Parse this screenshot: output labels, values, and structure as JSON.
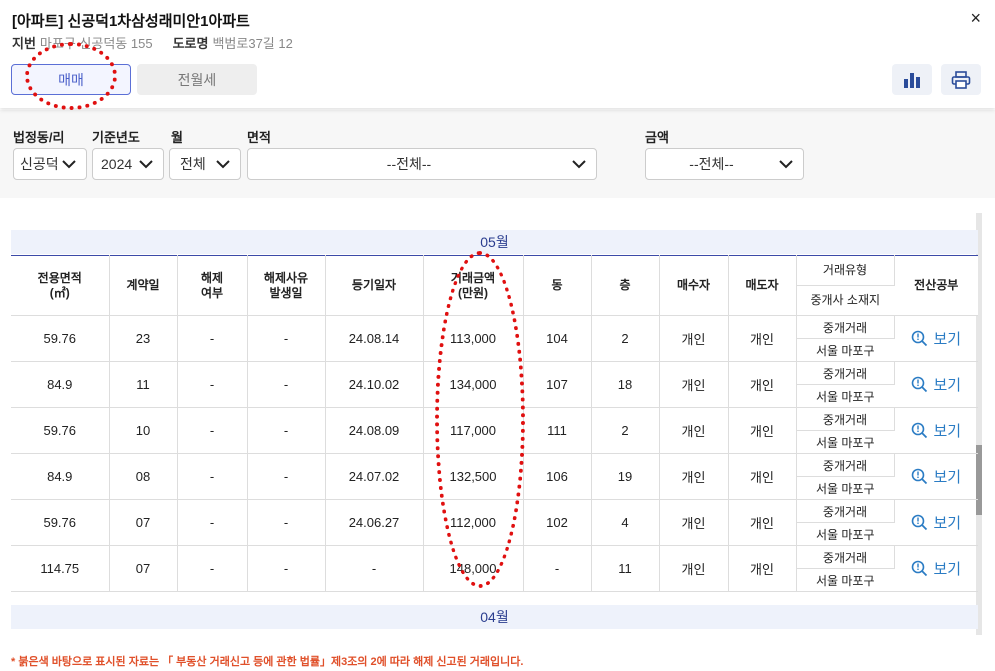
{
  "header": {
    "title": "[아파트] 신공덕1차삼성래미안1아파트",
    "lot_label": "지번",
    "lot_value": "마포구 신공덕동 155",
    "road_label": "도로명",
    "road_value": "백범로37길 12",
    "close": "×"
  },
  "tabs": [
    {
      "label": "매매",
      "active": true
    },
    {
      "label": "전월세",
      "active": false
    }
  ],
  "filters": {
    "dong": {
      "label": "법정동/리",
      "value": "신공덕"
    },
    "year": {
      "label": "기준년도",
      "value": "2024"
    },
    "month": {
      "label": "월",
      "value": "전체"
    },
    "area": {
      "label": "면적",
      "value": "--전체--"
    },
    "amount": {
      "label": "금액",
      "value": "--전체--"
    }
  },
  "table": {
    "headers": {
      "area": "전용면적\n(㎡)",
      "day": "계약일",
      "cancel": "해제\n여부",
      "cancel_date": "해제사유\n발생일",
      "reg_date": "등기일자",
      "price": "거래금액\n(만원)",
      "building": "동",
      "floor": "층",
      "buyer": "매수자",
      "seller": "매도자",
      "trade_type": "거래유형",
      "broker_loc": "중개사 소재지",
      "doc": "전산공부"
    },
    "month_may": "05월",
    "month_apr": "04월",
    "rows": [
      {
        "area": "59.76",
        "day": "23",
        "cancel": "-",
        "cancel_date": "-",
        "reg_date": "24.08.14",
        "price": "113,000",
        "building": "104",
        "floor": "2",
        "buyer": "개인",
        "seller": "개인",
        "trade_type": "중개거래",
        "broker_loc": "서울 마포구",
        "doc": "보기"
      },
      {
        "area": "84.9",
        "day": "11",
        "cancel": "-",
        "cancel_date": "-",
        "reg_date": "24.10.02",
        "price": "134,000",
        "building": "107",
        "floor": "18",
        "buyer": "개인",
        "seller": "개인",
        "trade_type": "중개거래",
        "broker_loc": "서울 마포구",
        "doc": "보기"
      },
      {
        "area": "59.76",
        "day": "10",
        "cancel": "-",
        "cancel_date": "-",
        "reg_date": "24.08.09",
        "price": "117,000",
        "building": "111",
        "floor": "2",
        "buyer": "개인",
        "seller": "개인",
        "trade_type": "중개거래",
        "broker_loc": "서울 마포구",
        "doc": "보기"
      },
      {
        "area": "84.9",
        "day": "08",
        "cancel": "-",
        "cancel_date": "-",
        "reg_date": "24.07.02",
        "price": "132,500",
        "building": "106",
        "floor": "19",
        "buyer": "개인",
        "seller": "개인",
        "trade_type": "중개거래",
        "broker_loc": "서울 마포구",
        "doc": "보기"
      },
      {
        "area": "59.76",
        "day": "07",
        "cancel": "-",
        "cancel_date": "-",
        "reg_date": "24.06.27",
        "price": "112,000",
        "building": "102",
        "floor": "4",
        "buyer": "개인",
        "seller": "개인",
        "trade_type": "중개거래",
        "broker_loc": "서울 마포구",
        "doc": "보기"
      },
      {
        "area": "114.75",
        "day": "07",
        "cancel": "-",
        "cancel_date": "-",
        "reg_date": "-",
        "price": "148,000",
        "building": "-",
        "floor": "11",
        "buyer": "개인",
        "seller": "개인",
        "trade_type": "중개거래",
        "broker_loc": "서울 마포구",
        "doc": "보기"
      }
    ]
  },
  "footnote": "* 붉은색 바탕으로 표시된 자료는 「 부동산 거래신고 등에 관한 법률」제3조의 2에 따라 해제 신고된 거래입니다.",
  "colors": {
    "accent": "#4a5fc9",
    "annotation": "#e01010",
    "link": "#2b7cc4",
    "note": "#e0502a"
  },
  "icons": {
    "close": "close-icon",
    "chart": "bar-chart-icon",
    "print": "printer-icon",
    "chevron": "chevron-down-icon",
    "view": "magnifier-icon"
  }
}
